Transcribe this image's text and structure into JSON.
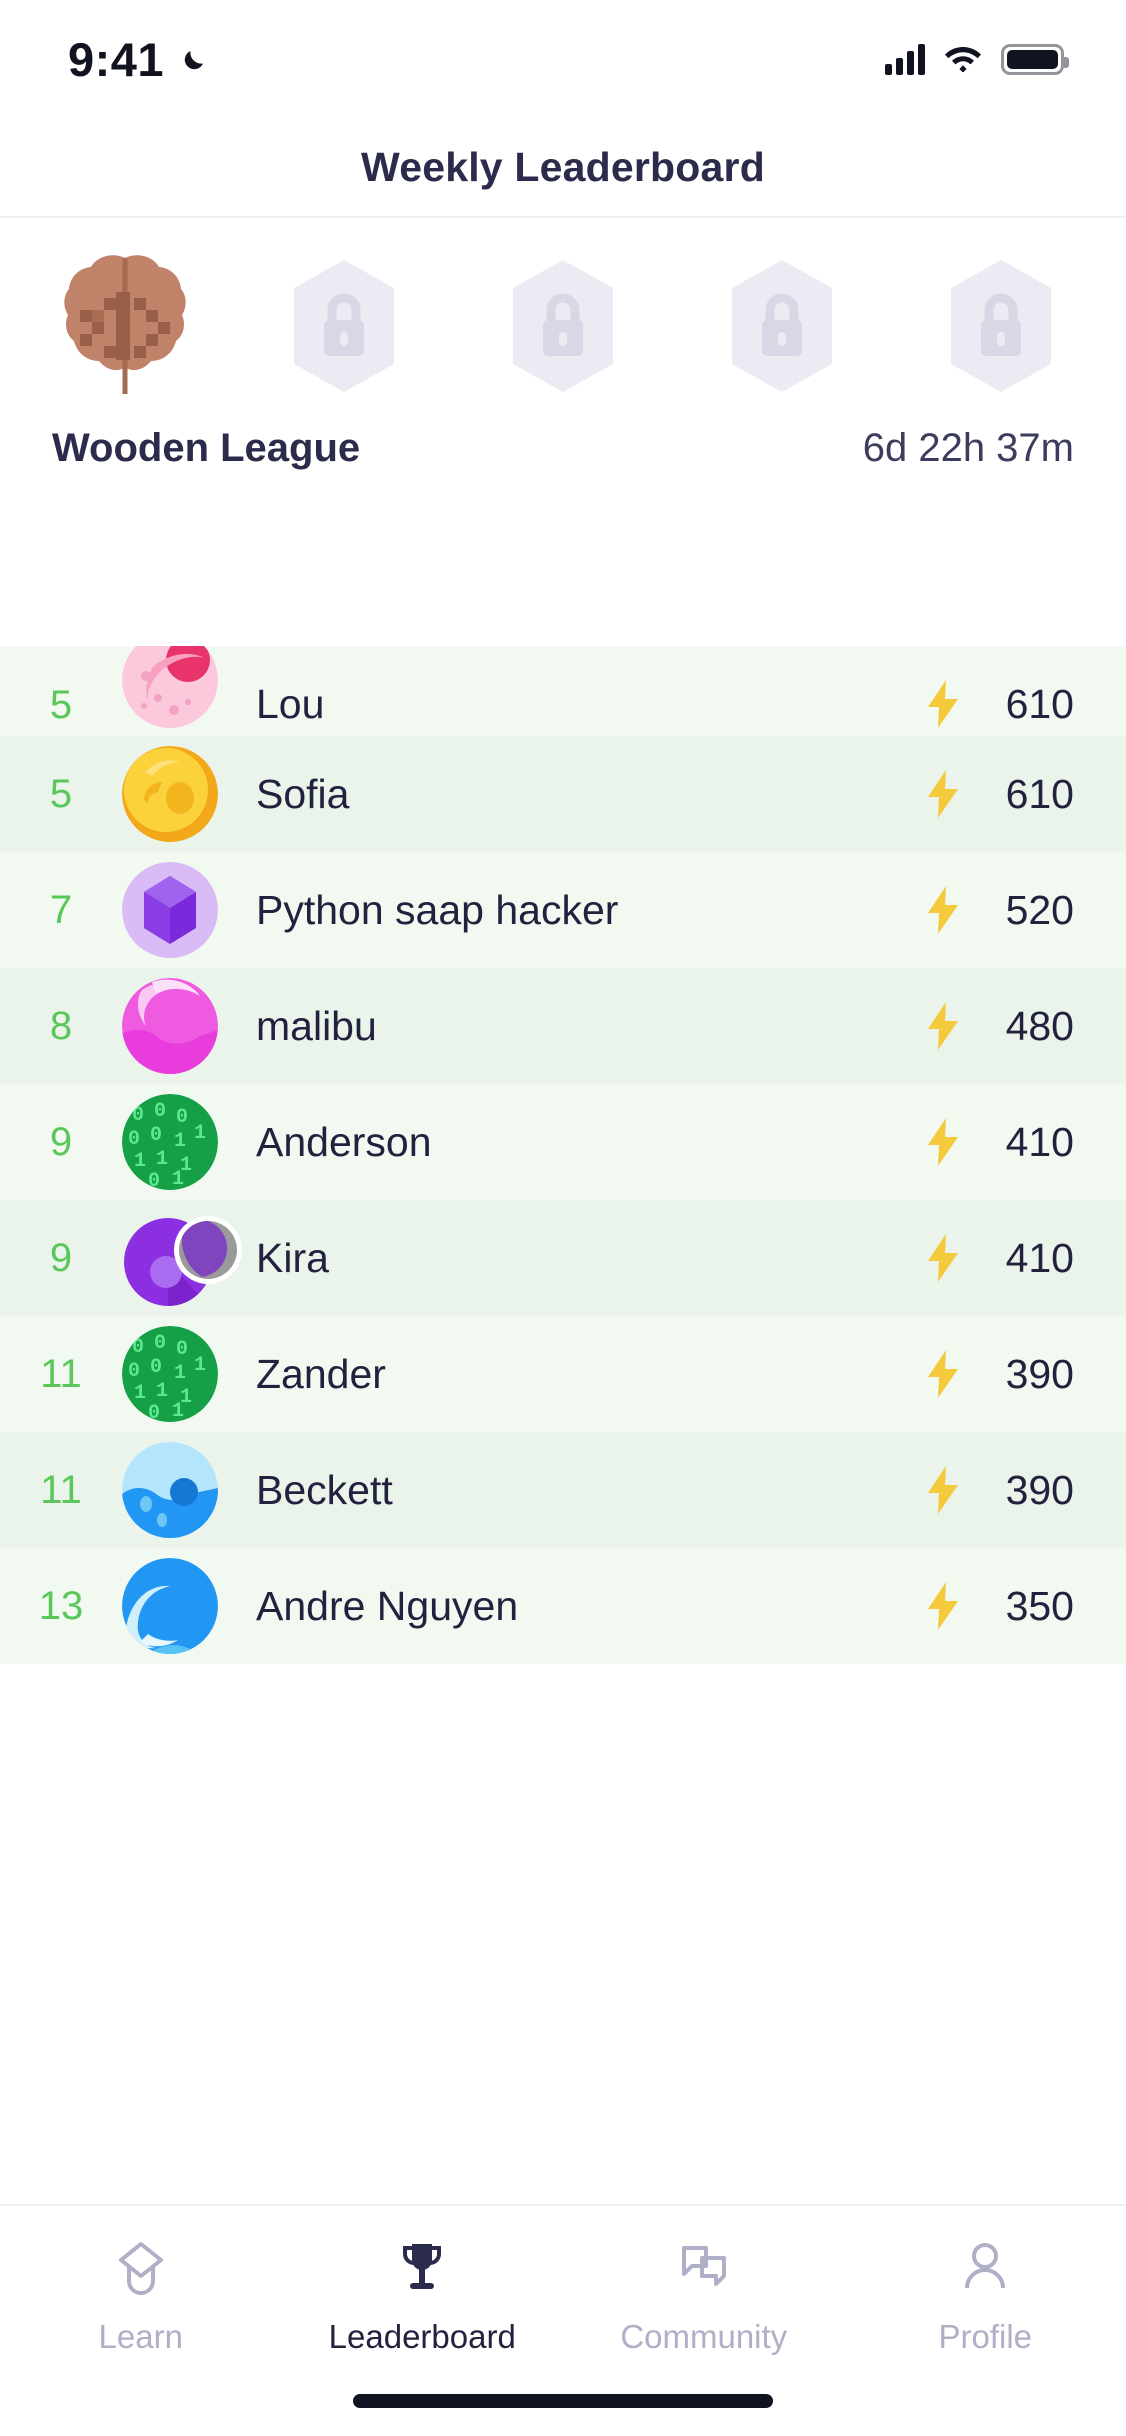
{
  "status_bar": {
    "time": "9:41",
    "dnd_icon": "moon-icon",
    "cellular_icon": "cellular-bars-icon",
    "wifi_icon": "wifi-icon",
    "battery_icon": "battery-icon"
  },
  "header": {
    "title": "Weekly Leaderboard"
  },
  "league": {
    "name": "Wooden League",
    "timer": "6d 22h 37m",
    "badges": [
      {
        "icon": "wooden-brain-badge-icon",
        "locked": false,
        "label": "Wooden League"
      },
      {
        "icon": "locked-badge-icon",
        "locked": true,
        "label": "Locked"
      },
      {
        "icon": "locked-badge-icon",
        "locked": true,
        "label": "Locked"
      },
      {
        "icon": "locked-badge-icon",
        "locked": true,
        "label": "Locked"
      },
      {
        "icon": "locked-badge-icon",
        "locked": true,
        "label": "Locked"
      }
    ]
  },
  "leaderboard": {
    "score_icon": "lightning-bolt-icon",
    "rows": [
      {
        "rank": "5",
        "name": "Lou",
        "score": "610",
        "avatar": "pink-planet-avatar",
        "current_user": false
      },
      {
        "rank": "5",
        "name": "Sofia",
        "score": "610",
        "avatar": "gold-coin-avatar",
        "current_user": false
      },
      {
        "rank": "7",
        "name": "Python saap hacker",
        "score": "520",
        "avatar": "purple-cube-avatar",
        "current_user": false
      },
      {
        "rank": "8",
        "name": "malibu",
        "score": "480",
        "avatar": "pink-swirl-avatar",
        "current_user": false
      },
      {
        "rank": "9",
        "name": "Anderson",
        "score": "410",
        "avatar": "green-binary-avatar",
        "current_user": false
      },
      {
        "rank": "9",
        "name": "Kira",
        "score": "410",
        "avatar": "purple-venn-avatar",
        "current_user": true
      },
      {
        "rank": "11",
        "name": "Zander",
        "score": "390",
        "avatar": "green-binary-avatar",
        "current_user": false
      },
      {
        "rank": "11",
        "name": "Beckett",
        "score": "390",
        "avatar": "blue-water-avatar",
        "current_user": false
      },
      {
        "rank": "13",
        "name": "Andre Nguyen",
        "score": "350",
        "avatar": "blue-wave-avatar",
        "current_user": false
      }
    ]
  },
  "tabbar": {
    "items": [
      {
        "label": "Learn",
        "icon": "graduation-cap-icon",
        "active": false
      },
      {
        "label": "Leaderboard",
        "icon": "trophy-icon",
        "active": true
      },
      {
        "label": "Community",
        "icon": "chat-bubbles-icon",
        "active": false
      },
      {
        "label": "Profile",
        "icon": "person-icon",
        "active": false
      }
    ]
  },
  "colors": {
    "accent_green": "#5BC75B",
    "text_dark": "#22223F",
    "title_navy": "#2B2B4B",
    "bolt_yellow": "#F5C93C",
    "row_light": "#F2F9F1",
    "row_alt": "#EAF4EA",
    "tab_inactive": "#AFAFC7"
  }
}
